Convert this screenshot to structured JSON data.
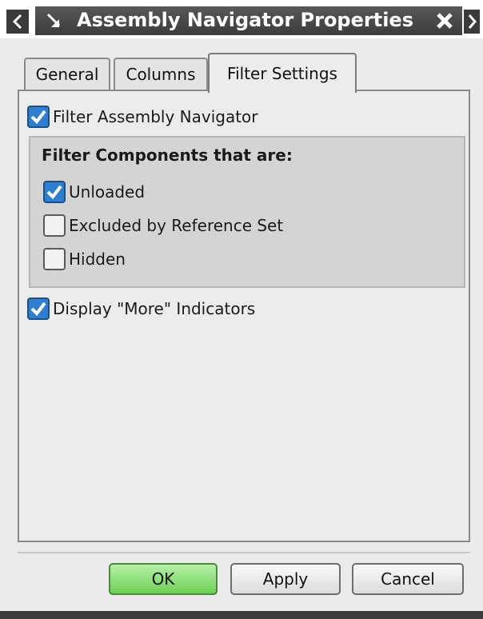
{
  "window": {
    "title": "Assembly Navigator Properties",
    "icons": {
      "prev": "chevron-left-icon",
      "next": "chevron-right-icon",
      "pin": "pin-icon",
      "close": "close-icon"
    }
  },
  "tabs": [
    {
      "label": "General",
      "selected": false
    },
    {
      "label": "Columns",
      "selected": false
    },
    {
      "label": "Filter Settings",
      "selected": true
    }
  ],
  "filter": {
    "filter_assembly_navigator": {
      "label": "Filter Assembly Navigator",
      "checked": true
    },
    "group_title": "Filter Components that are:",
    "options": [
      {
        "label": "Unloaded",
        "checked": true
      },
      {
        "label": "Excluded by Reference Set",
        "checked": false
      },
      {
        "label": "Hidden",
        "checked": false
      }
    ],
    "display_more_indicators": {
      "label": "Display \"More\" Indicators",
      "checked": true
    }
  },
  "buttons": {
    "ok": "OK",
    "apply": "Apply",
    "cancel": "Cancel"
  },
  "colors": {
    "accent_check": "#2f7fd1",
    "ok_button": "#6ed056",
    "title_bar": "#3c3c3c"
  }
}
